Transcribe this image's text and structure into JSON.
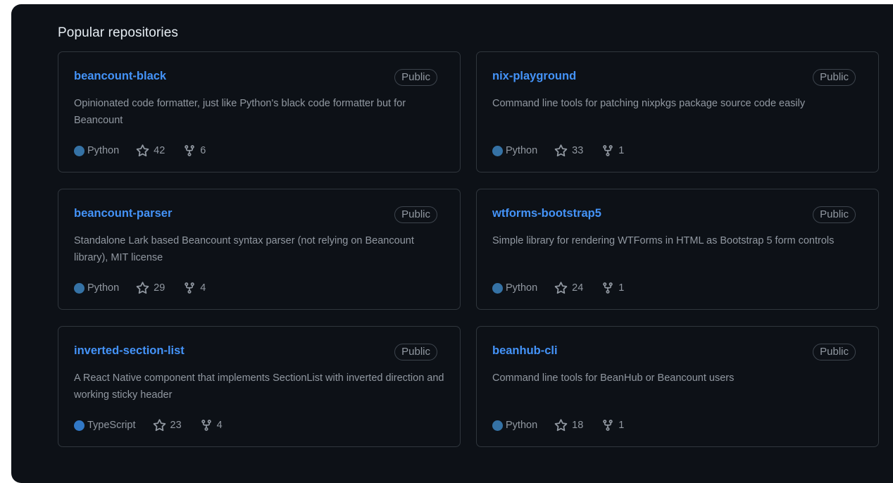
{
  "section": {
    "title": "Popular repositories"
  },
  "colors": {
    "python": "#3572A5",
    "typescript": "#3178c6",
    "link": "#4493f8"
  },
  "repos": [
    {
      "name": "beancount-black",
      "visibility": "Public",
      "description": "Opinionated code formatter, just like Python's black code formatter but for Beancount",
      "language": "Python",
      "stars": "42",
      "forks": "6"
    },
    {
      "name": "nix-playground",
      "visibility": "Public",
      "description": "Command line tools for patching nixpkgs package source code easily",
      "language": "Python",
      "stars": "33",
      "forks": "1"
    },
    {
      "name": "beancount-parser",
      "visibility": "Public",
      "description": "Standalone Lark based Beancount syntax parser (not relying on Beancount library), MIT license",
      "language": "Python",
      "stars": "29",
      "forks": "4"
    },
    {
      "name": "wtforms-bootstrap5",
      "visibility": "Public",
      "description": "Simple library for rendering WTForms in HTML as Bootstrap 5 form controls",
      "language": "Python",
      "stars": "24",
      "forks": "1"
    },
    {
      "name": "inverted-section-list",
      "visibility": "Public",
      "description": "A React Native component that implements SectionList with inverted direction and working sticky header",
      "language": "TypeScript",
      "stars": "23",
      "forks": "4"
    },
    {
      "name": "beanhub-cli",
      "visibility": "Public",
      "description": "Command line tools for BeanHub or Beancount users",
      "language": "Python",
      "stars": "18",
      "forks": "1"
    }
  ]
}
